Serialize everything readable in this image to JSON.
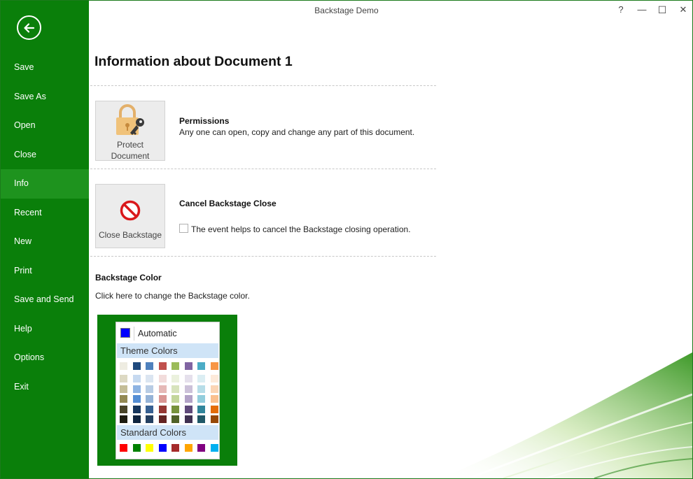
{
  "window": {
    "title": "Backstage Demo",
    "help": "?",
    "minimize": "—",
    "maximize": "☐",
    "close": "✕"
  },
  "sidebar": {
    "back_icon": "back-arrow-icon",
    "items": [
      {
        "label": "Save"
      },
      {
        "label": "Save As"
      },
      {
        "label": "Open"
      },
      {
        "label": "Close"
      },
      {
        "label": "Info",
        "active": true
      },
      {
        "label": "Recent"
      },
      {
        "label": "New"
      },
      {
        "label": "Print"
      },
      {
        "label": "Save and Send"
      },
      {
        "label": "Help"
      },
      {
        "label": "Options"
      },
      {
        "label": "Exit"
      }
    ]
  },
  "main": {
    "title": "Information about Document 1",
    "permissions": {
      "button_line1": "Protect",
      "button_line2": "Document",
      "icon": "lock-key-icon",
      "title": "Permissions",
      "text": "Any one can open, copy and change any part of this document."
    },
    "cancel": {
      "button_label": "Close Backstage",
      "icon": "no-entry-icon",
      "title": "Cancel Backstage Close",
      "checkbox_label": "The event helps to cancel the Backstage closing operation.",
      "checked": false
    },
    "color": {
      "title": "Backstage Color",
      "text": "Click here to change the Backstage color.",
      "current": "#0a7f0a"
    }
  },
  "color_picker": {
    "automatic_label": "Automatic",
    "automatic_color": "#0000ff",
    "theme_label": "Theme Colors",
    "standard_label": "Standard Colors",
    "theme_top": [
      "#eeece1",
      "#1f497d",
      "#4f81bd",
      "#c0504d",
      "#9bbb59",
      "#8064a2",
      "#4bacc6",
      "#f79646"
    ],
    "theme_shades": [
      [
        "#ddd9c3",
        "#c6d9f0",
        "#dbe5f1",
        "#f2dcdb",
        "#ebf1dd",
        "#e5e0ec",
        "#dbeef3",
        "#fdeada"
      ],
      [
        "#c4bd97",
        "#8db3e2",
        "#b8cce4",
        "#e5b9b7",
        "#d7e3bc",
        "#ccc1d9",
        "#b7dde8",
        "#fbd5b5"
      ],
      [
        "#938953",
        "#548dd4",
        "#95b3d7",
        "#d99694",
        "#c3d69b",
        "#b2a2c7",
        "#92cddc",
        "#fac08f"
      ],
      [
        "#494429",
        "#17365d",
        "#366092",
        "#953734",
        "#76923c",
        "#5f497a",
        "#31859b",
        "#e36c09"
      ],
      [
        "#1d1b10",
        "#0f243e",
        "#244061",
        "#632423",
        "#4f6128",
        "#3f3151",
        "#205867",
        "#974806"
      ]
    ],
    "standard": [
      "#ff0000",
      "#008000",
      "#ffff00",
      "#0000ff",
      "#a52a2a",
      "#ffa500",
      "#800080",
      "#00b0f0"
    ]
  }
}
